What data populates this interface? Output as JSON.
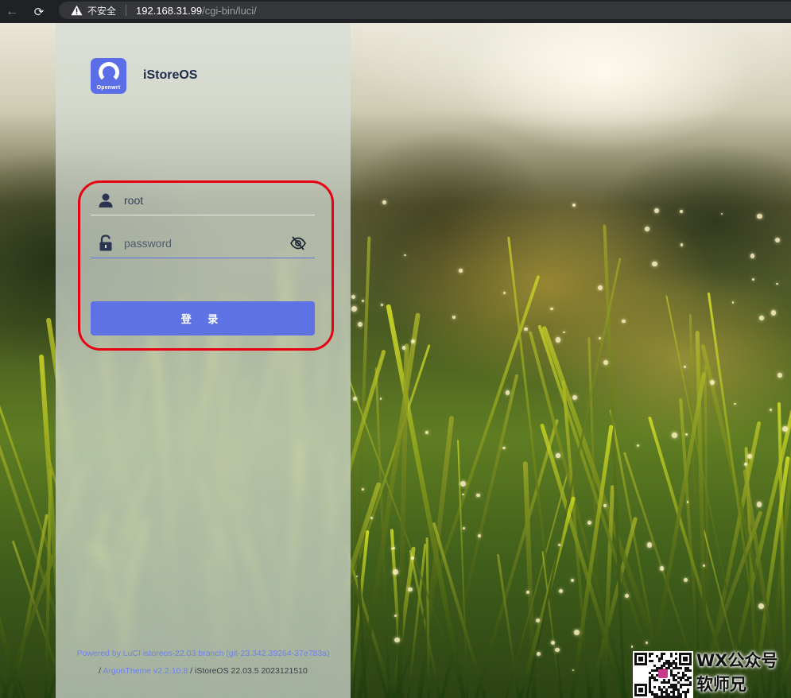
{
  "browser": {
    "insecure_label": "不安全",
    "url_host": "192.168.31.99",
    "url_path": "/cgi-bin/luci/"
  },
  "logo": {
    "text": "Openwrt"
  },
  "brand": {
    "name": "iStoreOS"
  },
  "login": {
    "username_value": "root",
    "password_placeholder": "password",
    "submit_label": "登 录"
  },
  "footer": {
    "powered_link": "Powered by LuCI istoreos-22.03 branch (git-23.342.39264-37e783a)",
    "theme_prefix": "/",
    "theme_link": "ArgonTheme v2.2.10.8",
    "version_text": "/ iStoreOS 22.03.5 2023121510"
  },
  "watermark": {
    "line1": "WX公众号",
    "line2": "软师兄"
  },
  "colors": {
    "accent": "#5e72e4",
    "highlight": "#e60012"
  }
}
